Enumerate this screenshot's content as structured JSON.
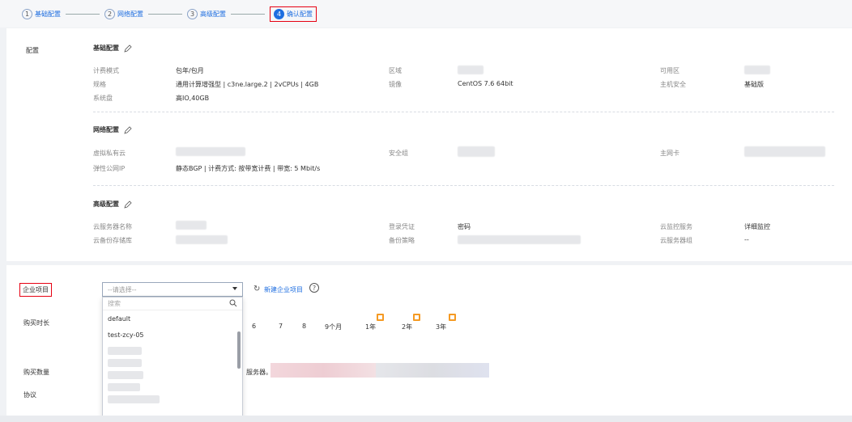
{
  "stepper": {
    "steps": [
      {
        "num": "1",
        "label": "基础配置"
      },
      {
        "num": "2",
        "label": "网络配置"
      },
      {
        "num": "3",
        "label": "高级配置"
      },
      {
        "num": "4",
        "label": "确认配置"
      }
    ]
  },
  "config": {
    "section_label": "配置",
    "basic": {
      "title": "基础配置",
      "billing_mode_label": "计费模式",
      "billing_mode_value": "包年/包月",
      "region_label": "区域",
      "az_label": "可用区",
      "spec_label": "规格",
      "spec_value": "通用计算增强型 | c3ne.large.2 | 2vCPUs | 4GB",
      "image_label": "镜像",
      "image_value": "CentOS 7.6 64bit",
      "host_security_label": "主机安全",
      "host_security_value": "基础版",
      "system_disk_label": "系统盘",
      "system_disk_value": "高IO,40GB"
    },
    "network": {
      "title": "网络配置",
      "vpc_label": "虚拟私有云",
      "security_group_label": "安全组",
      "primary_nic_label": "主网卡",
      "eip_label": "弹性公网IP",
      "eip_value": "静态BGP | 计费方式: 按带宽计费 | 带宽: 5 Mbit/s"
    },
    "advanced": {
      "title": "高级配置",
      "server_name_label": "云服务器名称",
      "login_label": "登录凭证",
      "login_value": "密码",
      "monitor_label": "云监控服务",
      "monitor_value": "详细监控",
      "backup_vault_label": "云备份存储库",
      "backup_policy_label": "备份策略",
      "server_group_label": "云服务器组",
      "server_group_value": "--"
    }
  },
  "enterprise": {
    "label": "企业项目",
    "select_placeholder": "--请选择--",
    "refresh_icon": "↻",
    "new_project_link": "新建企业项目",
    "help_icon": "?",
    "dropdown": {
      "search_placeholder": "搜索",
      "items": [
        "default",
        "test-zcy-05"
      ]
    }
  },
  "duration": {
    "label": "购买时长",
    "options": [
      "6",
      "7",
      "8",
      "9个月",
      "1年",
      "2年",
      "3年"
    ]
  },
  "quantity": {
    "label": "购买数量",
    "suffix": "服务器。"
  },
  "agreement": {
    "label": "协议"
  },
  "colors": {
    "accent": "#1e6ee0",
    "highlight_border": "#e60012",
    "gift_badge": "#f59a23"
  }
}
